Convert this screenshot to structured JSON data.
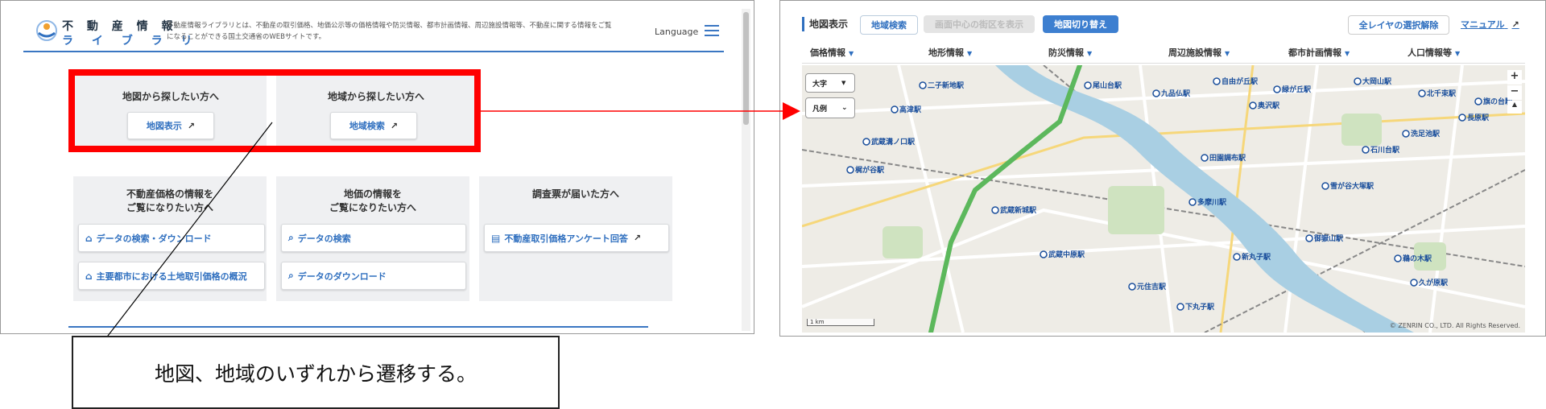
{
  "left": {
    "logo_line1": "不 動 産 情 報",
    "logo_line2": "ラ イ ブ ラ リ",
    "description": "不動産情報ライブラリとは、不動産の取引価格、地価公示等の価格情報や防災情報、都市計画情報、周辺施設情報等、不動産に関する情報をご覧になることができる国土交通省のWEBサイトです。",
    "language_label": "Language",
    "top_panels": [
      {
        "title": "地図から探したい方へ",
        "button": "地図表示"
      },
      {
        "title": "地域から探したい方へ",
        "button": "地域検索"
      }
    ],
    "bottom_panels": [
      {
        "title_line1": "不動産価格の情報を",
        "title_line2": "ご覧になりたい方へ",
        "buttons": [
          "データの検索・ダウンロード",
          "主要都市における土地取引価格の概況"
        ]
      },
      {
        "title_line1": "地価の情報を",
        "title_line2": "ご覧になりたい方へ",
        "buttons": [
          "データの検索",
          "データのダウンロード"
        ]
      },
      {
        "title_line1": "調査票が届いた方へ",
        "title_line2": "",
        "buttons": [
          "不動産取引価格アンケート回答"
        ]
      }
    ]
  },
  "right": {
    "toolbar": {
      "title": "地図表示",
      "region_search": "地域検索",
      "center_district": "画面中心の街区を表示",
      "map_switch": "地図切り替え",
      "clear_layers": "全レイヤの選択解除",
      "manual": "マニュアル"
    },
    "menu": [
      "価格情報",
      "地形情報",
      "防災情報",
      "周辺施設情報",
      "都市計画情報",
      "人口情報等"
    ],
    "map": {
      "size_select": "大字",
      "legend_select": "凡例",
      "zoom_in": "+",
      "zoom_out": "−",
      "north": "▲",
      "scale": "1 km",
      "copyright": "© ZENRIN CO., LTD. All Rights Reserved.",
      "stations": [
        "二子新地駅",
        "高津駅",
        "武蔵溝ノ口駅",
        "尾山台駅",
        "九品仏駅",
        "自由が丘駅",
        "緑が丘駅",
        "大岡山駅",
        "北千束駅",
        "旗の台駅",
        "長原駅",
        "洗足池駅",
        "石川台駅",
        "田園調布駅",
        "雪が谷大塚駅",
        "多摩川駅",
        "御嶽山駅",
        "武蔵新城駅",
        "武蔵中原駅",
        "新丸子駅",
        "元住吉駅",
        "下丸子駅",
        "鵜の木駅",
        "久が原駅",
        "梶が谷駅",
        "奥沢駅"
      ]
    },
    "colors": {
      "accent": "#2f6fbf",
      "river": "#a9cfe3",
      "route": "#5cb85c"
    }
  },
  "caption": "地図、地域のいずれから遷移する。",
  "colors": {
    "highlight": "#ff0000",
    "brand_blue": "#2f6fbf"
  }
}
